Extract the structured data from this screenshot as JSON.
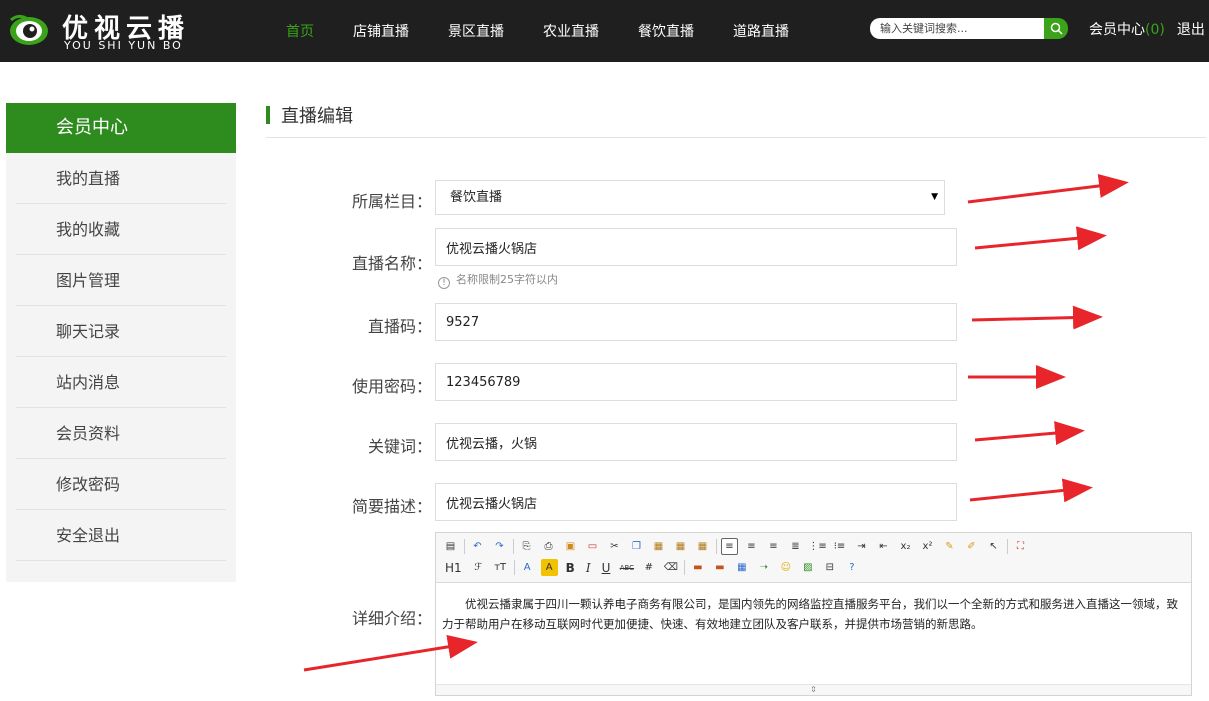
{
  "brand": {
    "name_cn": "优视云播",
    "name_en": "YOU SHI YUN BO"
  },
  "nav": {
    "items": [
      {
        "label": "首页"
      },
      {
        "label": "店铺直播"
      },
      {
        "label": "景区直播"
      },
      {
        "label": "农业直播"
      },
      {
        "label": "餐饮直播"
      },
      {
        "label": "道路直播"
      }
    ]
  },
  "search": {
    "placeholder": "输入关键词搜索..."
  },
  "user": {
    "center_label": "会员中心",
    "count": "(0)",
    "logout_label": "退出"
  },
  "sidebar": {
    "title": "会员中心",
    "items": [
      {
        "label": "我的直播"
      },
      {
        "label": "我的收藏"
      },
      {
        "label": "图片管理"
      },
      {
        "label": "聊天记录"
      },
      {
        "label": "站内消息"
      },
      {
        "label": "会员资料"
      },
      {
        "label": "修改密码"
      },
      {
        "label": "安全退出"
      }
    ]
  },
  "main": {
    "title": "直播编辑"
  },
  "form": {
    "category": {
      "label": "所属栏目：",
      "value": "餐饮直播"
    },
    "name": {
      "label": "直播名称：",
      "value": "优视云播火锅店",
      "hint": "名称限制25字符以内"
    },
    "code": {
      "label": "直播码：",
      "value": "9527"
    },
    "password": {
      "label": "使用密码：",
      "value": "123456789"
    },
    "keywords": {
      "label": "关键词：",
      "value": "优视云播，火锅"
    },
    "summary": {
      "label": "简要描述：",
      "value": "优视云播火锅店"
    },
    "detail": {
      "label": "详细介绍：",
      "content": "优视云播隶属于四川一颗认养电子商务有限公司，是国内领先的网络监控直播服务平台，我们以一个全新的方式和服务进入直播这一领域，致力于帮助用户在移动互联网时代更加便捷、快速、有效地建立团队及客户联系，并提供市场营销的新思路。"
    }
  },
  "editor": {
    "h1_label": "H1",
    "bold_label": "B",
    "italic_label": "I",
    "underline_label": "U"
  },
  "colors": {
    "accent": "#2e8b1e",
    "nav_active": "#3aa319",
    "header_bg": "#1f1f1f",
    "arrow": "#e8252b"
  }
}
